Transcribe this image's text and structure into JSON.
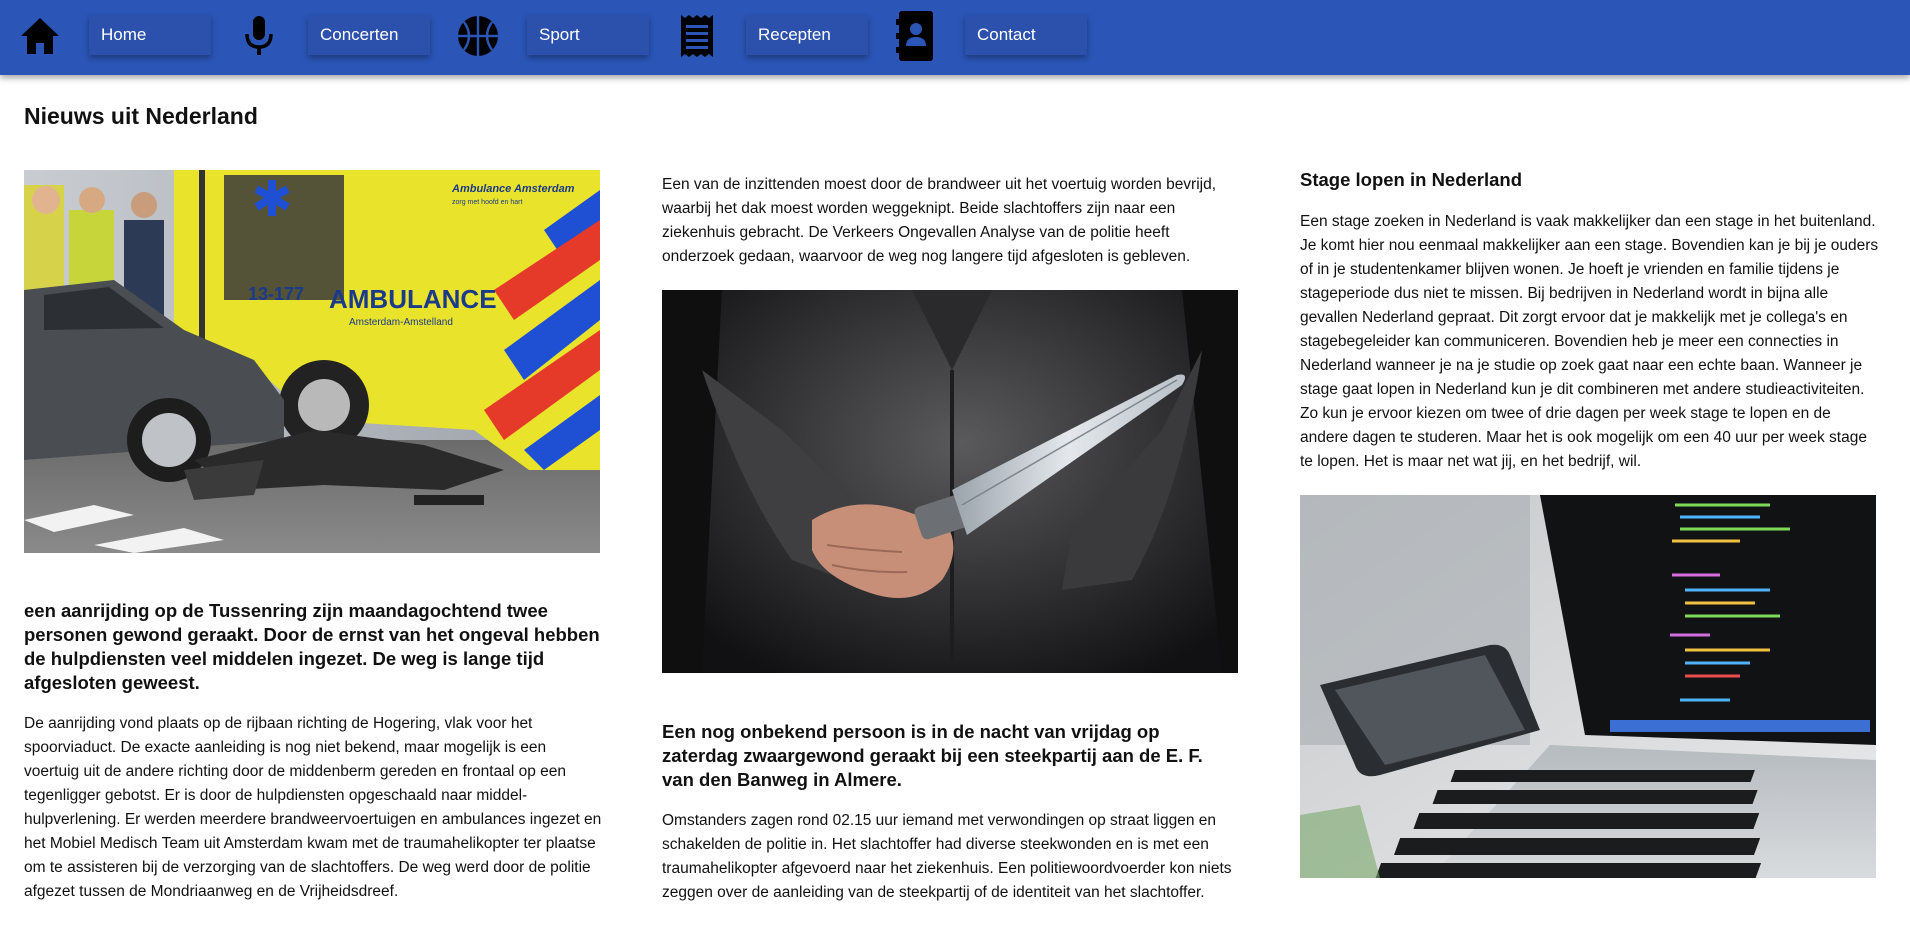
{
  "nav": {
    "items": [
      {
        "label": "Home",
        "icon": "home-icon"
      },
      {
        "label": "Concerten",
        "icon": "microphone-icon"
      },
      {
        "label": "Sport",
        "icon": "basketball-icon"
      },
      {
        "label": "Recepten",
        "icon": "receipt-icon"
      },
      {
        "label": "Contact",
        "icon": "contact-book-icon"
      }
    ]
  },
  "page": {
    "title": "Nieuws uit Nederland"
  },
  "articles": {
    "accident": {
      "headline": "een aanrijding op de Tussenring zijn maandagochtend twee personen gewond geraakt. Door de ernst van het ongeval hebben de hulpdiensten veel middelen ingezet. De weg is lange tijd afgesloten geweest.",
      "body": "De aanrijding vond plaats op de rijbaan richting de Hogering, vlak voor het spoorviaduct. De exacte aanleiding is nog niet bekend, maar mogelijk is een voertuig uit de andere richting door de middenberm gereden en frontaal op een tegenligger gebotst. Er is door de hulpdiensten opgeschaald naar middel-hulpverlening. Er werden meerdere brandweervoertuigen en ambulances ingezet en het Mobiel Medisch Team uit Amsterdam kwam met de traumahelikopter ter plaatse om te assisteren bij de verzorging van de slachtoffers. De weg werd door de politie afgezet tussen de Mondriaanweg en de Vrijheidsdreef.",
      "image": {
        "ambulance_number": "13-177",
        "ambulance_text": "AMBULANCE",
        "ambulance_region": "Amsterdam-Amstelland",
        "ambulance_brand": "Ambulance Amsterdam",
        "ambulance_slogan": "zorg met hoofd en hart"
      }
    },
    "stabbing": {
      "intro": "Een van de inzittenden moest door de brandweer uit het voertuig worden bevrijd, waarbij het dak moest worden weggeknipt. Beide slachtoffers zijn naar een ziekenhuis gebracht. De Verkeers Ongevallen Analyse van de politie heeft onderzoek gedaan, waarvoor de weg nog langere tijd afgesloten is gebleven.",
      "headline": "Een nog onbekend persoon is in de nacht van vrijdag op zaterdag zwaargewond geraakt bij een steekpartij aan de E. F. van den Banweg in Almere.",
      "body": "Omstanders zagen rond 02.15 uur iemand met verwondingen op straat liggen en schakelden de politie in. Het slachtoffer had diverse steekwonden en is met een traumahelikopter afgevoerd naar het ziekenhuis. Een politiewoordvoerder kon niets zeggen over de aanleiding van de steekpartij of de identiteit van het slachtoffer."
    },
    "internship": {
      "headline": "Stage lopen in Nederland",
      "body": "Een stage zoeken in Nederland is vaak makkelijker dan een stage in het buitenland. Je komt hier nou eenmaal makkelijker aan een stage. Bovendien kan je bij je ouders of in je studentenkamer blijven wonen. Je hoeft je vrienden en familie tijdens je stageperiode dus niet te missen. Bij bedrijven in Nederland wordt in bijna alle gevallen Nederland gepraat. Dit zorgt ervoor dat je makkelijk met je collega's en stagebegeleider kan communiceren. Bovendien heb je meer een connecties in Nederland wanneer je na je studie op zoek gaat naar een echte baan. Wanneer je stage gaat lopen in Nederland kun je dit combineren met andere studieactiviteiten. Zo kun je ervoor kiezen om twee of drie dagen per week stage te lopen en de andere dagen te studeren. Maar het is ook mogelijk om een 40 uur per week stage te lopen. Het is maar net wat jij, en het bedrijf, wil."
    }
  }
}
